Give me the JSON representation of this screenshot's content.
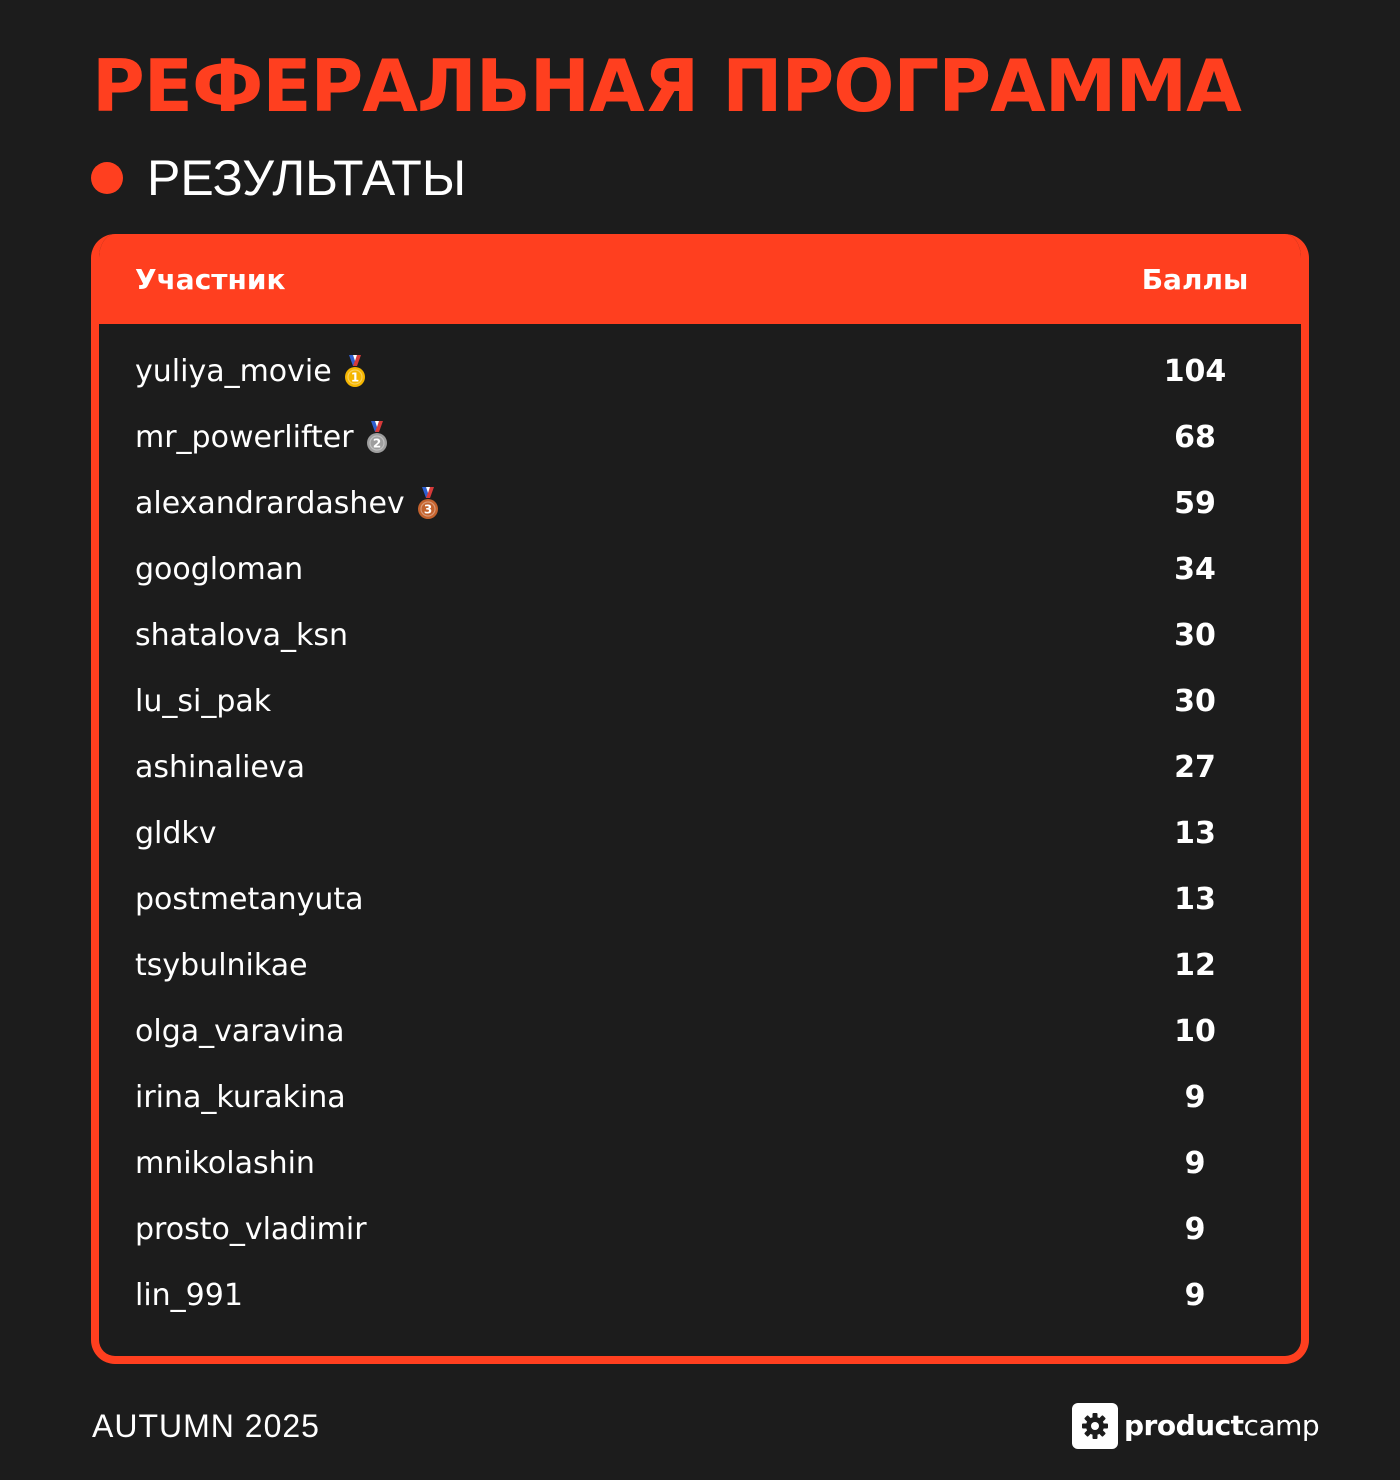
{
  "title": "РЕФЕРАЛЬНАЯ ПРОГРАММА",
  "subtitle": "РЕЗУЛЬТАТЫ",
  "colors": {
    "accent": "#ff3f1f",
    "background": "#1c1c1c",
    "text": "#ffffff",
    "gold": "#f5b600",
    "silver": "#9e9e9e",
    "bronze": "#c4622d"
  },
  "table": {
    "headers": {
      "participant": "Участник",
      "score": "Баллы"
    },
    "rows": [
      {
        "name": "yuliya_movie",
        "score": "104",
        "medal": "1",
        "medal_icon": "gold-medal-icon"
      },
      {
        "name": "mr_powerlifter",
        "score": "68",
        "medal": "2",
        "medal_icon": "silver-medal-icon"
      },
      {
        "name": "alexandrardashev",
        "score": "59",
        "medal": "3",
        "medal_icon": "bronze-medal-icon"
      },
      {
        "name": "googloman",
        "score": "34"
      },
      {
        "name": "shatalova_ksn",
        "score": "30"
      },
      {
        "name": "lu_si_pak",
        "score": "30"
      },
      {
        "name": "ashinalieva",
        "score": "27"
      },
      {
        "name": "gldkv",
        "score": "13"
      },
      {
        "name": "postmetanyuta",
        "score": "13"
      },
      {
        "name": "tsybulnikae",
        "score": "12"
      },
      {
        "name": "olga_varavina",
        "score": "10"
      },
      {
        "name": "irina_kurakina",
        "score": "9"
      },
      {
        "name": "mnikolashin",
        "score": "9"
      },
      {
        "name": "prosto_vladimir",
        "score": "9"
      },
      {
        "name": "lin_991",
        "score": "9"
      }
    ]
  },
  "footer": {
    "season": "AUTUMN 2025",
    "logo": {
      "bold": "product",
      "regular": "camp",
      "icon": "gear-icon"
    }
  }
}
